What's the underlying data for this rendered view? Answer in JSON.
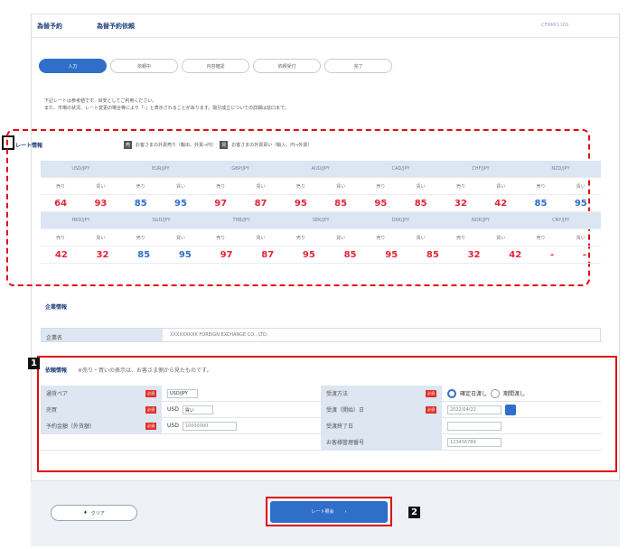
{
  "header": {
    "breadcrumb": "為替予約",
    "title": "為替予約依頼",
    "code": "CFMKK1109"
  },
  "steps": [
    "入力",
    "依頼中",
    "内容確認",
    "依頼受付",
    "完了"
  ],
  "notice": [
    "下記レートは参考値です。目安としてご利用ください。",
    "また、市場の状況、レート変更の場合等により「-」と表示されることがあります。取引成立についての詳細は窓口まで。"
  ],
  "rate_section": {
    "title": "レート情報",
    "legend1": "お客さまの外貨売り（輸出、外貨→円）",
    "legend2": "お客さまの外貨買い（輸入、円→外貨）"
  },
  "rates": [
    {
      "pairs": [
        "USD/JPY",
        "EUR/JPY",
        "GBP/JPY",
        "AUD/JPY",
        "CAD/JPY",
        "CHF/JPY",
        "NZD/JPY"
      ],
      "values": [
        "64",
        "93",
        "85",
        "95",
        "97",
        "87",
        "95",
        "85",
        "95",
        "85",
        "32",
        "42",
        "85",
        "95"
      ]
    },
    {
      "pairs": [
        "HKD/JPY",
        "SGD/JPY",
        "THB/JPY",
        "SEK/JPY",
        "DKK/JPY",
        "NOK/JPY",
        "CNY/JPY"
      ],
      "values": [
        "42",
        "32",
        "85",
        "95",
        "97",
        "87",
        "95",
        "85",
        "95",
        "85",
        "32",
        "42",
        "-",
        "-"
      ]
    }
  ],
  "company": {
    "title": "企業情報",
    "label": "企業名",
    "value": "XXXXXXXXX FOREIGN EXCHANGE CO., LTD."
  },
  "order": {
    "title": "依頼情報",
    "note": "※売り・買いの表示は、お客さま側から見たものです。",
    "left": [
      {
        "label": "通貨ペア",
        "value": "USD/JPY"
      },
      {
        "label": "売買",
        "currency": "USD",
        "value": "買い"
      },
      {
        "label": "予約金額（外貨額）",
        "currency": "USD",
        "value": "10000000"
      }
    ],
    "right": [
      {
        "label": "受渡方法",
        "value1": "確定日渡し",
        "value2": "期間渡し"
      },
      {
        "label": "受渡（開始）日",
        "value": "2022/04/22"
      },
      {
        "label": "受渡終了日",
        "value": ""
      },
      {
        "label": "お客様管理番号",
        "value": "123456789"
      }
    ]
  },
  "buttons": {
    "clear": "クリア",
    "rate": "レート照会"
  },
  "markers": {
    "doc": "",
    "one": "1",
    "two": "2"
  }
}
